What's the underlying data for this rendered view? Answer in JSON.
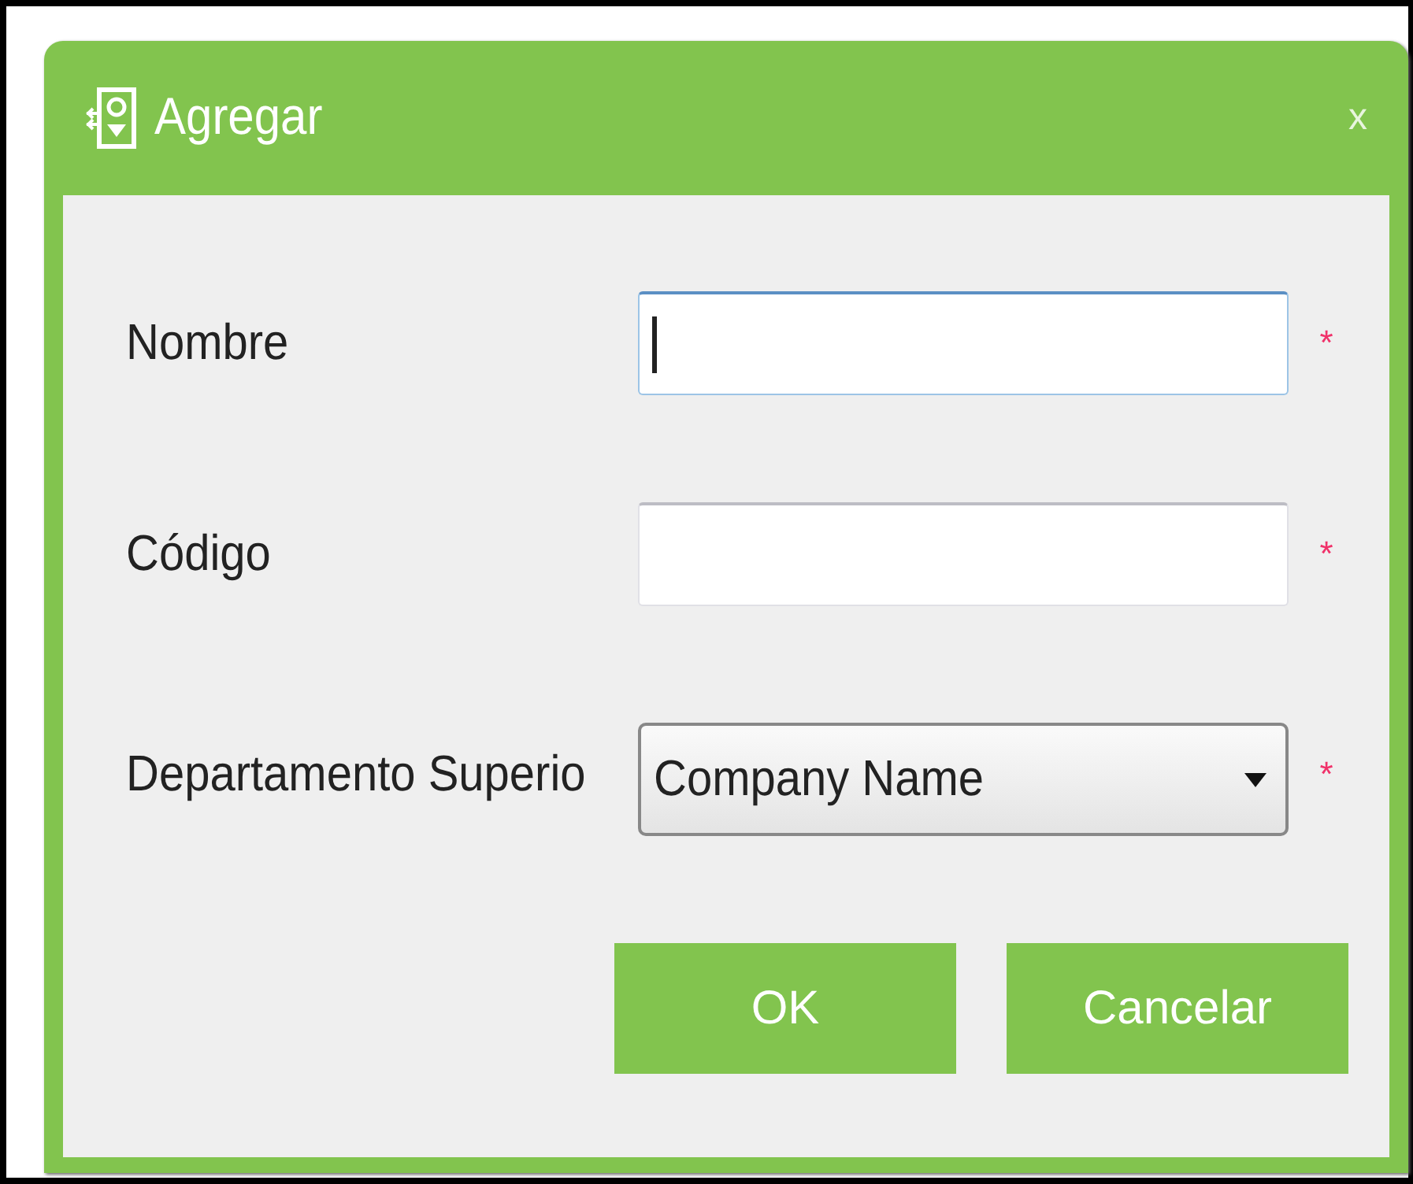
{
  "dialog": {
    "title": "Agregar",
    "close": "x"
  },
  "fields": [
    {
      "kind": "text",
      "label": "Nombre",
      "focused": true,
      "required_mark": "*"
    },
    {
      "kind": "text",
      "label": "Código",
      "focused": false,
      "required_mark": "*"
    },
    {
      "kind": "select",
      "label": "Departamento Superio",
      "value": "Company Name",
      "required_mark": "*"
    }
  ],
  "buttons": [
    "OK",
    "Cancelar"
  ]
}
